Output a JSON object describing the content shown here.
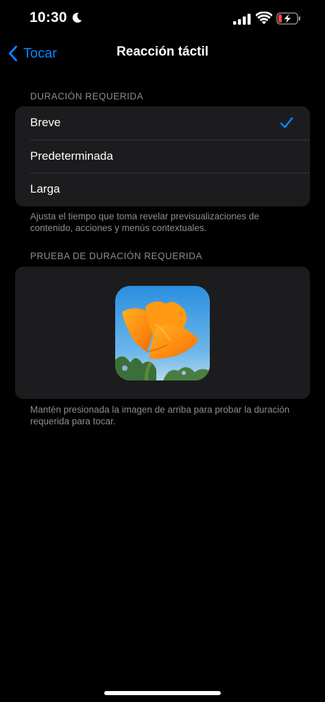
{
  "status_bar": {
    "time": "10:30"
  },
  "nav": {
    "back_label": "Tocar",
    "title": "Reacción táctil"
  },
  "duration": {
    "header": "DURACIÓN REQUERIDA",
    "options": [
      {
        "label": "Breve",
        "selected": true
      },
      {
        "label": "Predeterminada",
        "selected": false
      },
      {
        "label": "Larga",
        "selected": false
      }
    ],
    "footer": "Ajusta el tiempo que toma revelar previsualizaciones de contenido, acciones y menús contextuales."
  },
  "test": {
    "header": "PRUEBA DE DURACIÓN REQUERIDA",
    "footer": "Mantén presionada la imagen de arriba para probar la duración requerida para tocar."
  },
  "colors": {
    "accent": "#0a84ff",
    "background": "#000000",
    "group": "#1c1c1e",
    "secondary_text": "#8e8e93",
    "battery_low": "#ff453a"
  },
  "icons": [
    "moon-icon",
    "cellular-signal-icon",
    "wifi-icon",
    "battery-charging-icon",
    "chevron-left-icon",
    "checkmark-icon"
  ]
}
